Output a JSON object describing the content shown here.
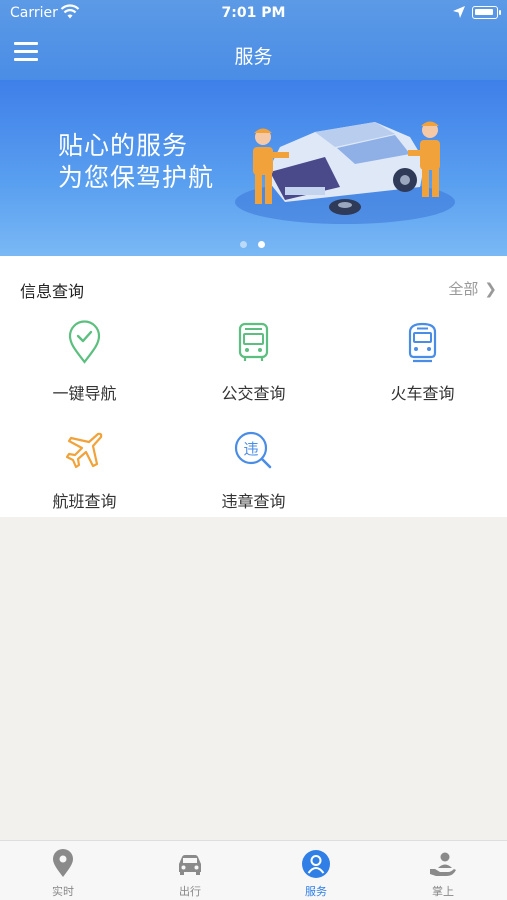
{
  "status_bar": {
    "carrier": "Carrier",
    "time": "7:01 PM"
  },
  "nav": {
    "title": "服务"
  },
  "banner": {
    "line1": "贴心的服务",
    "line2": "为您保驾护航",
    "slide_count": 2,
    "active_slide": 2
  },
  "info": {
    "title": "信息查询",
    "more_label": "全部",
    "items": [
      {
        "label": "一键导航",
        "icon": "location-check-icon",
        "color": "#5cbf7f"
      },
      {
        "label": "公交查询",
        "icon": "bus-icon",
        "color": "#5cbf7f"
      },
      {
        "label": "火车查询",
        "icon": "train-icon",
        "color": "#4a8de6"
      },
      {
        "label": "航班查询",
        "icon": "airplane-icon",
        "color": "#f2a23a"
      },
      {
        "label": "违章查询",
        "icon": "violation-search-icon",
        "color": "#4a8de6"
      }
    ]
  },
  "tabbar": {
    "tabs": [
      {
        "label": "实时",
        "icon": "location-pin-icon",
        "active": false
      },
      {
        "label": "出行",
        "icon": "car-icon",
        "active": false
      },
      {
        "label": "服务",
        "icon": "user-icon",
        "active": true
      },
      {
        "label": "掌上",
        "icon": "hand-user-icon",
        "active": false
      }
    ]
  },
  "colors": {
    "header_blue": "#4a8de6",
    "active_tab": "#2f7fe6",
    "inactive_tab": "#888888"
  }
}
